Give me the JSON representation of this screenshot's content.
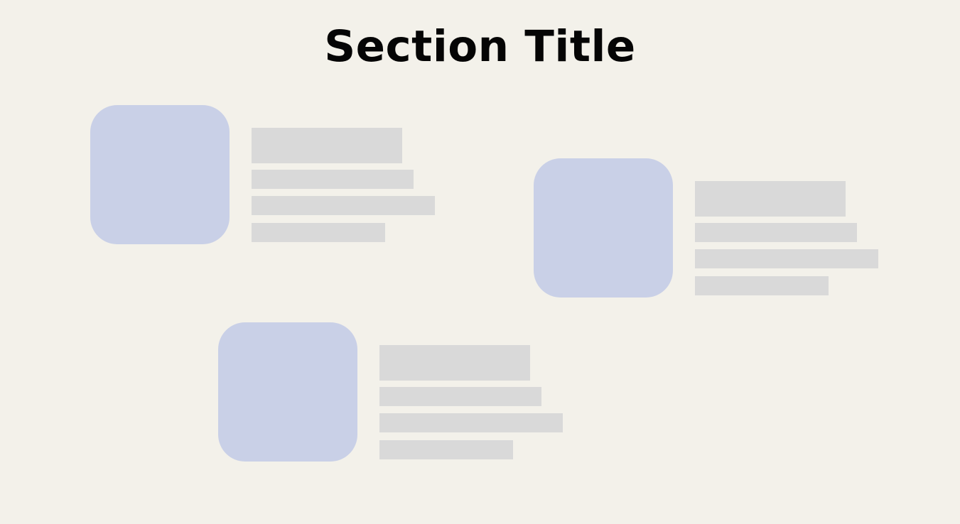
{
  "page": {
    "title": "Section Title",
    "colors": {
      "background": "#f3f1ea",
      "title": "#050505",
      "image_placeholder": "#c9d0e7",
      "text_placeholder": "#d9d9d9"
    }
  },
  "cards": [
    {
      "name": "card-1",
      "image_placeholder": "image-placeholder",
      "text_placeholders": [
        "title-placeholder",
        "text-line-placeholder",
        "text-line-placeholder",
        "text-line-placeholder"
      ]
    },
    {
      "name": "card-2",
      "image_placeholder": "image-placeholder",
      "text_placeholders": [
        "title-placeholder",
        "text-line-placeholder",
        "text-line-placeholder",
        "text-line-placeholder"
      ]
    },
    {
      "name": "card-3",
      "image_placeholder": "image-placeholder",
      "text_placeholders": [
        "title-placeholder",
        "text-line-placeholder",
        "text-line-placeholder",
        "text-line-placeholder"
      ]
    }
  ]
}
